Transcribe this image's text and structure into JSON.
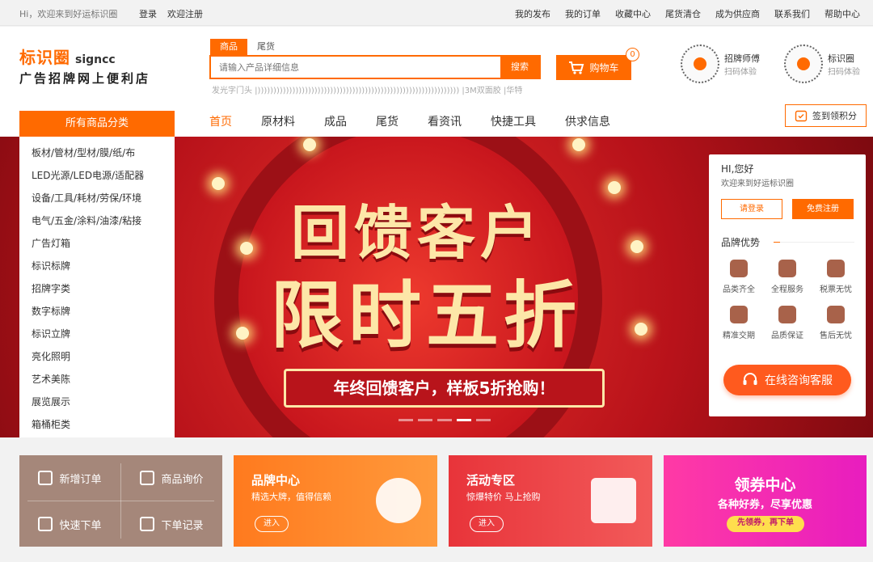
{
  "topbar": {
    "greeting": "Hi，欢迎来到好运标识圈",
    "login": "登录",
    "register": "欢迎注册",
    "links": [
      "我的发布",
      "我的订单",
      "收藏中心",
      "尾货清仓",
      "成为供应商",
      "联系我们",
      "帮助中心"
    ]
  },
  "logo": {
    "mark": "标识圈",
    "en": "signcc",
    "sub": "广告招牌网上便利店"
  },
  "search": {
    "tabs": [
      "商品",
      "尾货"
    ],
    "placeholder": "请输入产品详细信息",
    "button": "搜索",
    "hotwords": "发光字门头 |)))))))))))))))))))))))))))))))))))))))))))))))))))))))))))))))) |3M双面胶 |华特"
  },
  "cart": {
    "label": "购物车",
    "count": "0"
  },
  "qr": [
    {
      "title": "招牌师傅",
      "sub": "扫码体验"
    },
    {
      "title": "标识圈",
      "sub": "扫码体验"
    }
  ],
  "nav": {
    "category": "所有商品分类",
    "items": [
      "首页",
      "原材料",
      "成品",
      "尾货",
      "看资讯",
      "快捷工具",
      "供求信息"
    ],
    "signin": "签到领积分"
  },
  "categories": [
    "板材/管材/型材/膜/纸/布",
    "LED光源/LED电源/适配器",
    "设备/工具/耗材/劳保/环境",
    "电气/五金/涂料/油漆/粘接",
    "广告灯箱",
    "标识标牌",
    "招牌字类",
    "数字标牌",
    "标识立牌",
    "亮化照明",
    "艺术美陈",
    "展览展示",
    "箱桶柜类"
  ],
  "banner": {
    "line1": "回馈客户",
    "line2": "限时五折",
    "ribbon": "年终回馈客户，样板5折抢购！"
  },
  "side": {
    "hi": "HI,您好",
    "welcome": "欢迎来到好运标识圈",
    "login": "请登录",
    "register": "免费注册",
    "advantage": "品牌优势",
    "features": [
      "品类齐全",
      "全程服务",
      "税票无忧",
      "精准交期",
      "品质保证",
      "售后无忧"
    ],
    "service": "在线咨询客服"
  },
  "quick": [
    "新增订单",
    "商品询价",
    "快速下单",
    "下单记录"
  ],
  "cards": [
    {
      "title": "品牌中心",
      "sub": "精选大牌，值得信赖",
      "btn": "进入"
    },
    {
      "title": "活动专区",
      "sub": "惊爆特价 马上抢购",
      "btn": "进入"
    },
    {
      "title": "领券中心",
      "sub": "各种好券，尽享优惠",
      "btn": "先领券，再下单"
    }
  ]
}
